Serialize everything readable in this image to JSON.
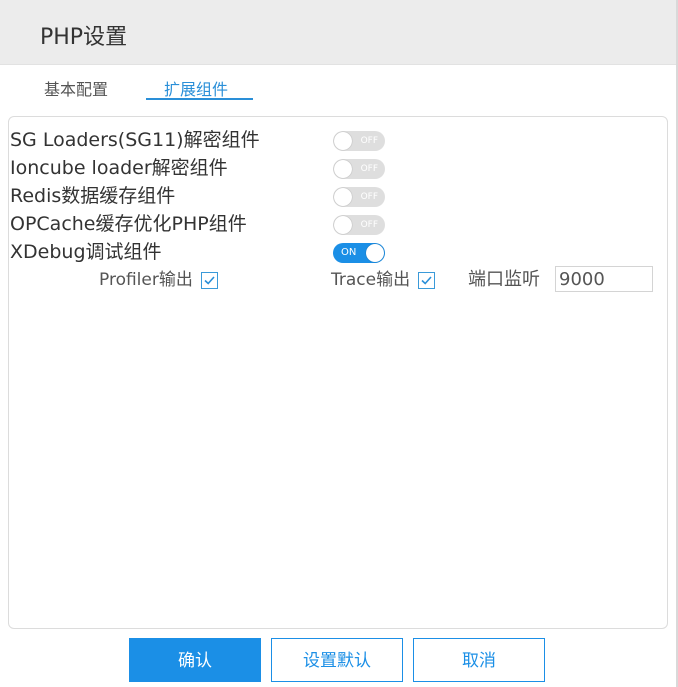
{
  "window": {
    "title": "PHP设置"
  },
  "tabs": [
    {
      "label": "基本配置",
      "active": false
    },
    {
      "label": "扩展组件",
      "active": true
    }
  ],
  "components": [
    {
      "label": "SG Loaders(SG11)解密组件",
      "state": "OFF",
      "enabled": false
    },
    {
      "label": "Ioncube loader解密组件",
      "state": "OFF",
      "enabled": false
    },
    {
      "label": "Redis数据缓存组件",
      "state": "OFF",
      "enabled": false
    },
    {
      "label": "OPCache缓存优化PHP组件",
      "state": "OFF",
      "enabled": false
    },
    {
      "label": "XDebug调试组件",
      "state": "ON",
      "enabled": true
    }
  ],
  "xdebug": {
    "profiler_label": "Profiler输出",
    "profiler_checked": true,
    "trace_label": "Trace输出",
    "trace_checked": true,
    "port_label": "端口监听",
    "port_value": "9000"
  },
  "buttons": {
    "confirm": "确认",
    "set_default": "设置默认",
    "cancel": "取消"
  },
  "colors": {
    "accent": "#1b8fe6",
    "toggle_off": "#dedede",
    "titlebar_bg": "#ececec"
  }
}
